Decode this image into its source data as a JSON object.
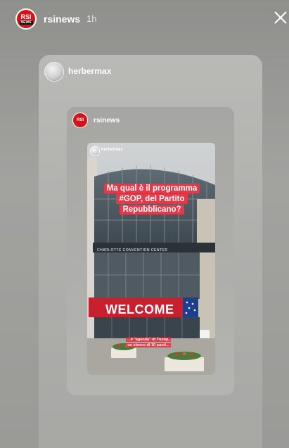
{
  "story": {
    "username": "rsinews",
    "time": "1h",
    "avatar_logo": {
      "line1": "RSI",
      "line2": "NEWS"
    }
  },
  "shared_post": {
    "username": "herbermax",
    "nested_post": {
      "username": "rsinews",
      "avatar_text": "RSI",
      "photo": {
        "username": "herbermax",
        "question": "Ma qual è il programma #GOP, del Partito Repubblicano?",
        "sign": "CHARLOTTE CONVENTION CENTER",
        "banner": "WELCOME",
        "caption": "...il \"agenda\" di Trump, un elenco di 10 punti..."
      }
    }
  },
  "colors": {
    "brand_red": "#d4121a",
    "caption_red": "#e5394a",
    "background_gray": "#9c9c99"
  },
  "icons": {
    "close": "close-icon"
  }
}
